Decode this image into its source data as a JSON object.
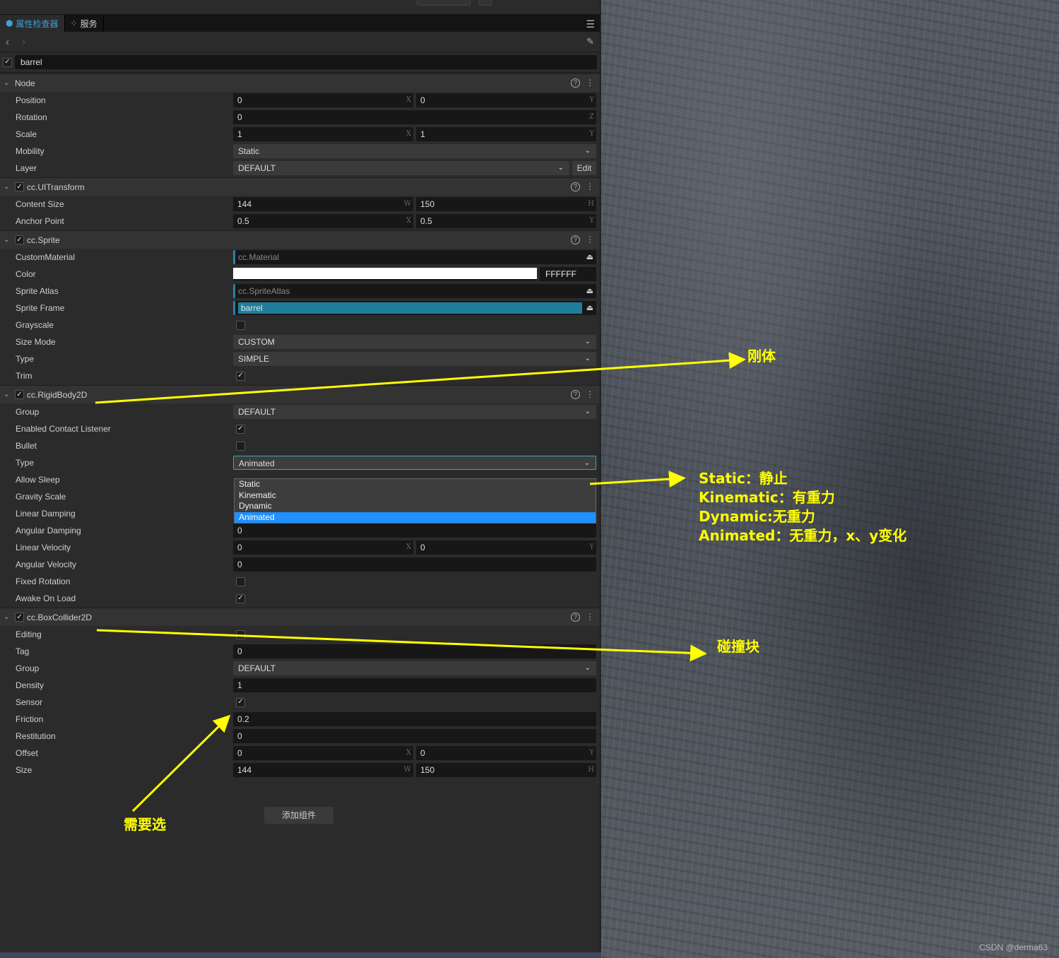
{
  "tabs": [
    {
      "label": "属性检查器",
      "icon": "inspector-icon",
      "active": true
    },
    {
      "label": "服务",
      "icon": "services-icon",
      "active": false
    }
  ],
  "node_name": "barrel",
  "node_enabled": true,
  "sections": [
    {
      "title": "Node",
      "checkbox": false,
      "rows": [
        {
          "label": "Position",
          "type": "vec2",
          "values": [
            "0",
            "0"
          ],
          "axes": [
            "X",
            "Y"
          ]
        },
        {
          "label": "Rotation",
          "type": "num",
          "value": "0",
          "axis": "Z"
        },
        {
          "label": "Scale",
          "type": "vec2",
          "values": [
            "1",
            "1"
          ],
          "axes": [
            "X",
            "Y"
          ]
        },
        {
          "label": "Mobility",
          "type": "select",
          "value": "Static"
        },
        {
          "label": "Layer",
          "type": "select-edit",
          "value": "DEFAULT",
          "button": "Edit"
        }
      ]
    },
    {
      "title": "cc.UITransform",
      "checkbox": true,
      "rows": [
        {
          "label": "Content Size",
          "type": "vec2",
          "values": [
            "144",
            "150"
          ],
          "axes": [
            "W",
            "H"
          ]
        },
        {
          "label": "Anchor Point",
          "type": "vec2",
          "values": [
            "0.5",
            "0.5"
          ],
          "axes": [
            "X",
            "Y"
          ]
        }
      ]
    },
    {
      "title": "cc.Sprite",
      "checkbox": true,
      "rows": [
        {
          "label": "CustomMaterial",
          "type": "asset",
          "value": "cc.Material"
        },
        {
          "label": "Color",
          "type": "color",
          "value": "FFFFFF",
          "color": "#ffffff"
        },
        {
          "label": "Sprite Atlas",
          "type": "asset",
          "value": "cc.SpriteAtlas"
        },
        {
          "label": "Sprite Frame",
          "type": "asset-filled",
          "value": "barrel"
        },
        {
          "label": "Grayscale",
          "type": "check",
          "checked": false
        },
        {
          "label": "Size Mode",
          "type": "select",
          "value": "CUSTOM"
        },
        {
          "label": "Type",
          "type": "select",
          "value": "SIMPLE"
        },
        {
          "label": "Trim",
          "type": "check",
          "checked": true
        }
      ]
    },
    {
      "title": "cc.RigidBody2D",
      "checkbox": true,
      "rows": [
        {
          "label": "Group",
          "type": "select",
          "value": "DEFAULT"
        },
        {
          "label": "Enabled Contact Listener",
          "type": "check",
          "checked": true
        },
        {
          "label": "Bullet",
          "type": "check",
          "checked": false
        },
        {
          "label": "Type",
          "type": "select-open",
          "value": "Animated"
        },
        {
          "label": "Allow Sleep",
          "type": "empty"
        },
        {
          "label": "Gravity Scale",
          "type": "empty"
        },
        {
          "label": "Linear Damping",
          "type": "empty"
        },
        {
          "label": "Angular Damping",
          "type": "num",
          "value": "0"
        },
        {
          "label": "Linear Velocity",
          "type": "vec2",
          "values": [
            "0",
            "0"
          ],
          "axes": [
            "X",
            "Y"
          ]
        },
        {
          "label": "Angular Velocity",
          "type": "num",
          "value": "0"
        },
        {
          "label": "Fixed Rotation",
          "type": "check",
          "checked": false
        },
        {
          "label": "Awake On Load",
          "type": "check",
          "checked": true
        }
      ]
    },
    {
      "title": "cc.BoxCollider2D",
      "checkbox": true,
      "rows": [
        {
          "label": "Editing",
          "type": "check",
          "checked": false
        },
        {
          "label": "Tag",
          "type": "num",
          "value": "0"
        },
        {
          "label": "Group",
          "type": "select",
          "value": "DEFAULT"
        },
        {
          "label": "Density",
          "type": "num",
          "value": "1"
        },
        {
          "label": "Sensor",
          "type": "check",
          "checked": true
        },
        {
          "label": "Friction",
          "type": "num",
          "value": "0.2"
        },
        {
          "label": "Restitution",
          "type": "num",
          "value": "0"
        },
        {
          "label": "Offset",
          "type": "vec2",
          "values": [
            "0",
            "0"
          ],
          "axes": [
            "X",
            "Y"
          ]
        },
        {
          "label": "Size",
          "type": "vec2",
          "values": [
            "144",
            "150"
          ],
          "axes": [
            "W",
            "H"
          ]
        }
      ]
    }
  ],
  "type_dropdown": {
    "options": [
      "Static",
      "Kinematic",
      "Dynamic",
      "Animated"
    ],
    "selected": "Animated"
  },
  "add_component_label": "添加组件",
  "annotations": {
    "rigidbody": "刚体",
    "types": [
      "Static：静止",
      "Kinematic：有重力",
      "Dynamic:无重力",
      "Animated：无重力，x、y变化"
    ],
    "collider": "碰撞块",
    "sensor": "需要选"
  },
  "annotation_color": "#ffff00",
  "accent_color": "#1e90ff",
  "watermark": "CSDN @derma63"
}
